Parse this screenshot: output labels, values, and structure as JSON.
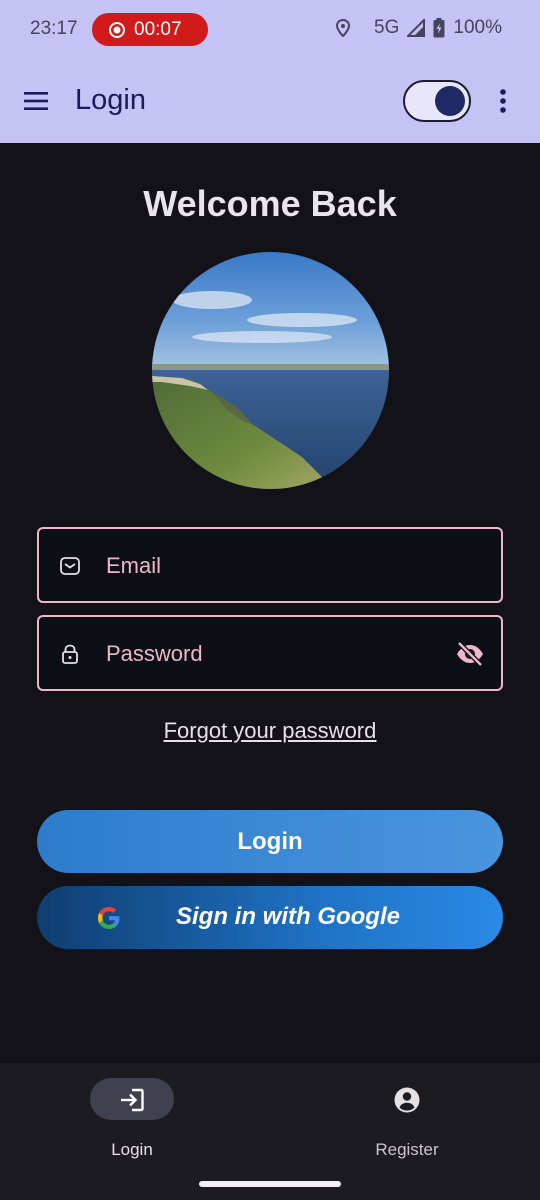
{
  "status_bar": {
    "time": "23:17",
    "recording_time": "00:07",
    "network": "5G",
    "battery": "100%",
    "icons": [
      "record-icon",
      "location-icon",
      "signal-icon",
      "battery-charging-icon"
    ]
  },
  "app_bar": {
    "title": "Login",
    "icons": [
      "menu-icon",
      "more-vert-icon"
    ],
    "theme_toggle_on": true
  },
  "main": {
    "welcome": "Welcome Back",
    "avatar": "coastal-landscape-photo",
    "email_label": "Email",
    "password_label": "Password",
    "forgot_link": "Forgot your password",
    "login_button": "Login",
    "google_button": "Sign in with Google"
  },
  "bottom_nav": {
    "items": [
      {
        "label": "Login",
        "icon": "login-icon",
        "selected": true
      },
      {
        "label": "Register",
        "icon": "account-circle-icon",
        "selected": false
      }
    ]
  },
  "colors": {
    "app_bar": "#c5c3f5",
    "background": "#131218",
    "field_outline": "#efb8c8",
    "recording": "#d11a1a",
    "login_button": "#3a89d6",
    "google_button": "#1f72c4"
  }
}
